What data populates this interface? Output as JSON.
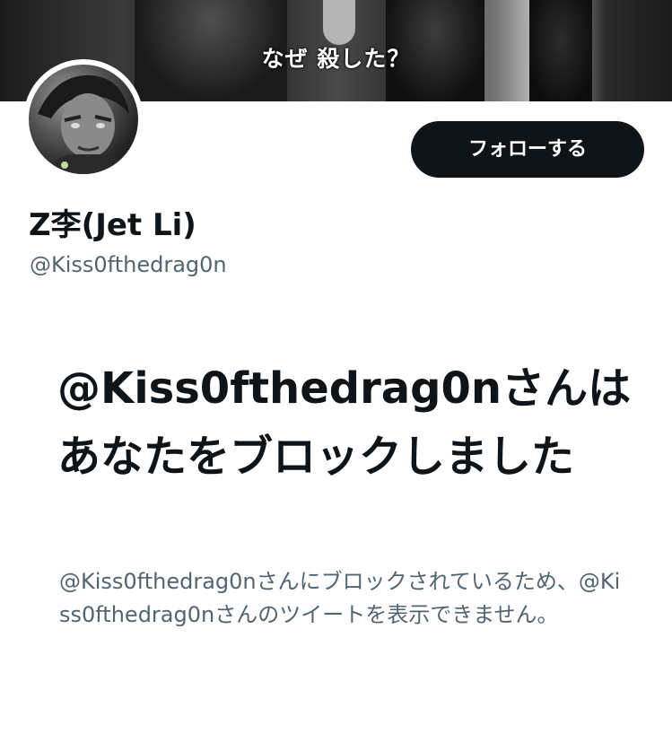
{
  "banner": {
    "caption": "なぜ 殺した？"
  },
  "profile": {
    "display_name": "Z李(Jet Li)",
    "handle": "@Kiss0fthedrag0n",
    "follow_label": "フォローする"
  },
  "blocked": {
    "title": "@Kiss0fthedrag0nさんはあなたをブロックしました",
    "description": "@Kiss0fthedrag0nさんにブロックされているため、@Kiss0fthedrag0nさんのツイートを表示できません。"
  },
  "colors": {
    "button_bg": "#0f1419",
    "secondary_text": "#536471"
  }
}
